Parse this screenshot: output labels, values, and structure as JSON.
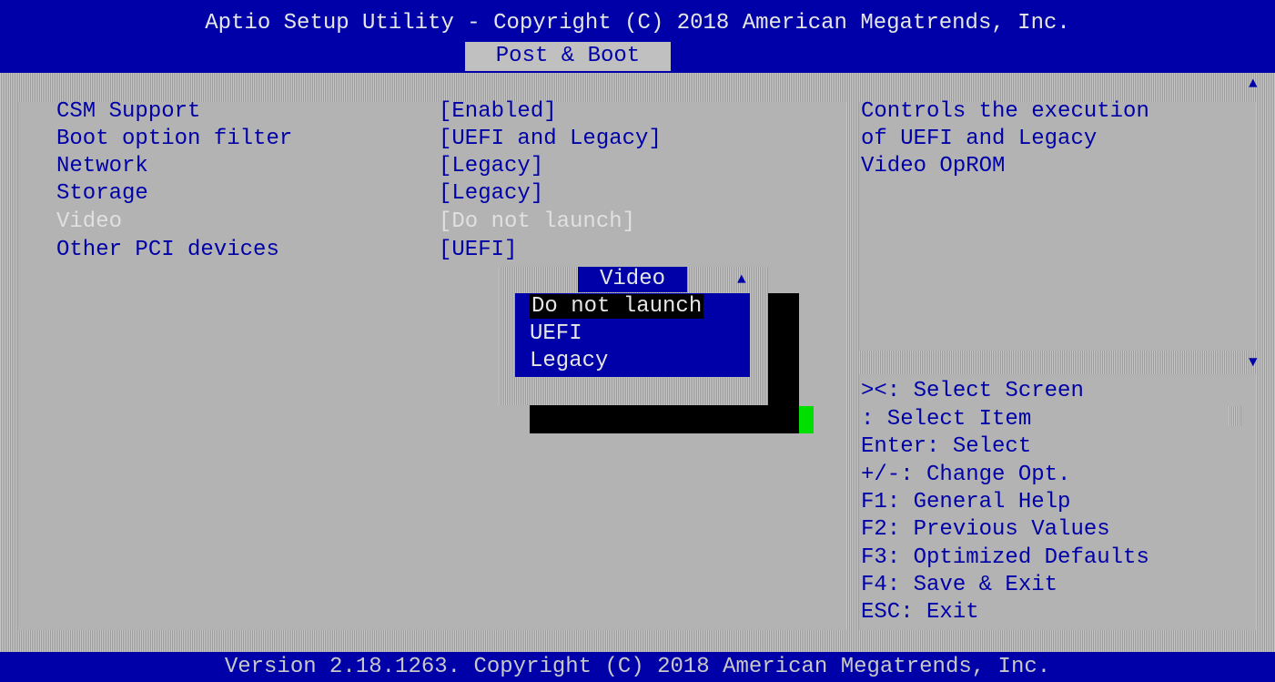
{
  "header": {
    "title": "Aptio Setup Utility - Copyright (C) 2018 American Megatrends, Inc.",
    "active_tab": "Post & Boot"
  },
  "settings": [
    {
      "label": "CSM Support",
      "value": "[Enabled]"
    },
    {
      "label": "Boot option filter",
      "value": "[UEFI and Legacy]"
    },
    {
      "label": "Network",
      "value": "[Legacy]"
    },
    {
      "label": "Storage",
      "value": "[Legacy]"
    },
    {
      "label": "Video",
      "value": "[Do not launch]"
    },
    {
      "label": "Other PCI devices",
      "value": "[UEFI]"
    }
  ],
  "popup": {
    "title": "Video",
    "options": [
      "Do not launch",
      "UEFI",
      "Legacy"
    ],
    "selected": "Do not launch"
  },
  "help": {
    "description": [
      "Controls the execution",
      "of UEFI and Legacy",
      "Video OpROM"
    ],
    "keys": [
      "><: Select Screen",
      ": Select Item",
      "Enter: Select",
      "+/-: Change Opt.",
      "F1: General Help",
      "F2: Previous Values",
      "F3: Optimized Defaults",
      "F4: Save & Exit",
      "ESC: Exit"
    ]
  },
  "footer": {
    "version": "Version 2.18.1263. Copyright (C) 2018 American Megatrends, Inc."
  },
  "colors": {
    "background": "#b3b3b3",
    "blue": "#0000a8",
    "text_light": "#e6e6e6",
    "disabled_text": "#e0e0e0",
    "cursor_green": "#00e000"
  }
}
